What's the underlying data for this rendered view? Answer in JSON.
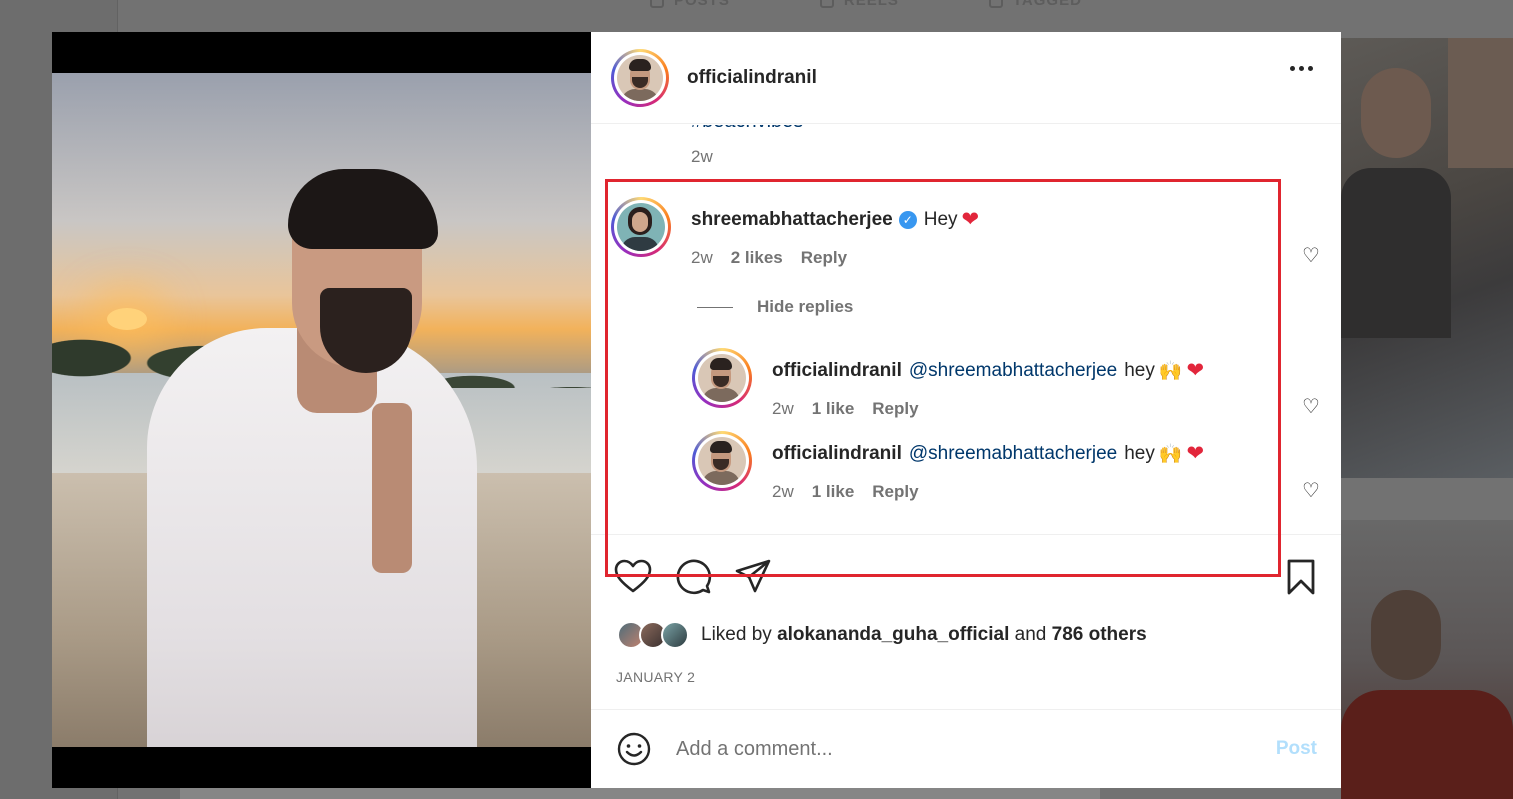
{
  "background": {
    "tabs": [
      "POSTS",
      "REELS",
      "TAGGED"
    ]
  },
  "post": {
    "header": {
      "username": "officialindranil"
    },
    "caption": {
      "tail_text": "#beachvibes",
      "time": "2w"
    },
    "comments": [
      {
        "username": "shreemabhattacherjee",
        "verified": true,
        "text": "Hey",
        "emoji": "❤",
        "time": "2w",
        "likes": "2 likes",
        "reply_label": "Reply"
      }
    ],
    "hide_replies_label": "Hide replies",
    "replies": [
      {
        "username": "officialindranil",
        "mention": "@shreemabhattacherjee",
        "text": "hey",
        "emoji1": "🙌",
        "emoji2": "❤",
        "time": "2w",
        "likes": "1 like",
        "reply_label": "Reply"
      },
      {
        "username": "officialindranil",
        "mention": "@shreemabhattacherjee",
        "text": "hey",
        "emoji1": "🙌",
        "emoji2": "❤",
        "time": "2w",
        "likes": "1 like",
        "reply_label": "Reply"
      }
    ],
    "liked_by": {
      "prefix": "Liked by",
      "user": "alokananda_guha_official",
      "middle": "and",
      "others": "786 others"
    },
    "date": "JANUARY 2",
    "comment_box": {
      "placeholder": "Add a comment...",
      "post_label": "Post"
    }
  },
  "colors": {
    "highlight_box": "#e0252f",
    "link": "#00376b",
    "verified": "#3897f0",
    "post_button_disabled": "#b2dffc"
  }
}
